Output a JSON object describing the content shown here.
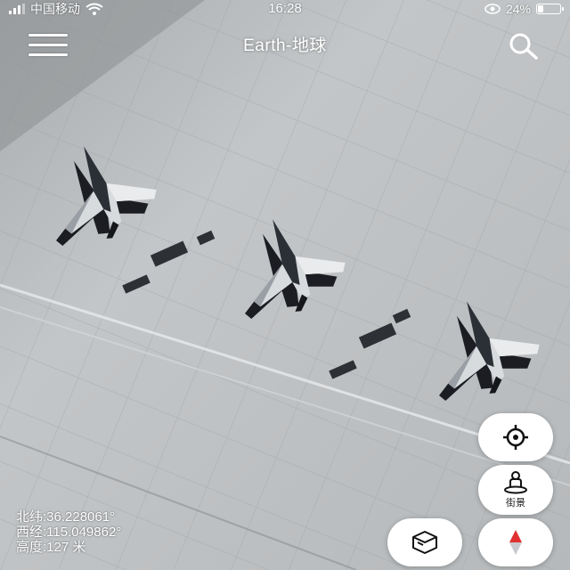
{
  "status_bar": {
    "carrier": "中国移动",
    "time": "16:28",
    "battery": "24%",
    "battery_level": 0.24
  },
  "header": {
    "title": "Earth-地球",
    "menu_icon": "hamburger-menu-icon",
    "search_icon": "search-icon"
  },
  "controls": {
    "locate_icon": "crosshair-icon",
    "street_view_icon": "pegman-icon",
    "street_view_label": "街景",
    "view_3d_icon": "3d-box-icon",
    "compass_icon": "compass-icon"
  },
  "coordinates": {
    "latitude": "北纬:36.228061°",
    "longitude": "西经:115.049862°",
    "altitude": "高度:127 米"
  },
  "colors": {
    "tarmac": "#bfc2c4",
    "compass_north": "#e03030"
  }
}
